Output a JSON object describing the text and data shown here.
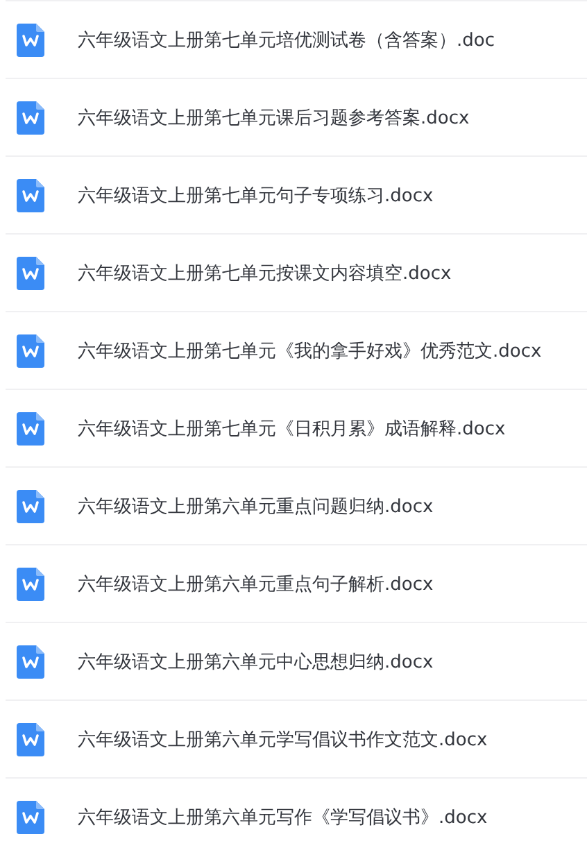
{
  "files": [
    {
      "name": "六年级语文上册第七单元培优测试卷（含答案）.doc"
    },
    {
      "name": "六年级语文上册第七单元课后习题参考答案.docx"
    },
    {
      "name": "六年级语文上册第七单元句子专项练习.docx"
    },
    {
      "name": "六年级语文上册第七单元按课文内容填空.docx"
    },
    {
      "name": "六年级语文上册第七单元《我的拿手好戏》优秀范文.docx"
    },
    {
      "name": "六年级语文上册第七单元《日积月累》成语解释.docx"
    },
    {
      "name": "六年级语文上册第六单元重点问题归纳.docx"
    },
    {
      "name": "六年级语文上册第六单元重点句子解析.docx"
    },
    {
      "name": "六年级语文上册第六单元中心思想归纳.docx"
    },
    {
      "name": "六年级语文上册第六单元学写倡议书作文范文.docx"
    },
    {
      "name": "六年级语文上册第六单元写作《学写倡议书》.docx"
    }
  ]
}
